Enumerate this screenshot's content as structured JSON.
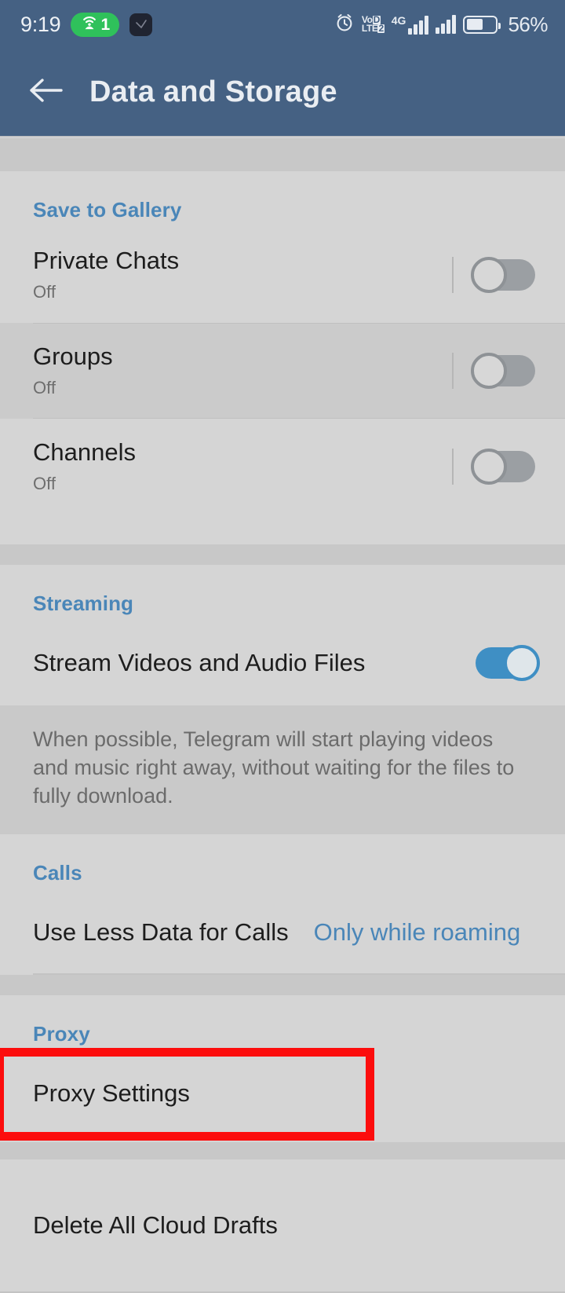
{
  "status_bar": {
    "time": "9:19",
    "hotspot_count": "1",
    "volte_top": "Vo",
    "volte_top_sq": "D",
    "volte_bottom": "LTE",
    "volte_bottom_sq": "2",
    "network_label": "4G",
    "battery_percent": "56%"
  },
  "app_bar": {
    "title": "Data and Storage",
    "back_icon": "arrow-left-icon",
    "background_color": "#456183"
  },
  "theme": {
    "accent_blue": "#4a86b8",
    "toggle_on_color": "#3f8fc4",
    "toggle_off_color": "#9b9fa3",
    "card_background": "#d5d5d5",
    "page_background": "#c8c8c8",
    "annotation_color": "#fc0d0d"
  },
  "sections": {
    "save_to_gallery": {
      "title": "Save to Gallery",
      "rows": [
        {
          "title": "Private Chats",
          "subtitle": "Off",
          "toggle": "off"
        },
        {
          "title": "Groups",
          "subtitle": "Off",
          "toggle": "off"
        },
        {
          "title": "Channels",
          "subtitle": "Off",
          "toggle": "off"
        }
      ]
    },
    "streaming": {
      "title": "Streaming",
      "row": {
        "title": "Stream Videos and Audio Files",
        "toggle": "on"
      },
      "description": "When possible, Telegram will start playing videos and music right away, without waiting for the files to fully download."
    },
    "calls": {
      "title": "Calls",
      "row": {
        "label": "Use Less Data for Calls",
        "value": "Only while roaming"
      }
    },
    "proxy": {
      "title": "Proxy",
      "row": {
        "label": "Proxy Settings"
      }
    },
    "other": {
      "row": {
        "label": "Delete All Cloud Drafts"
      }
    }
  }
}
